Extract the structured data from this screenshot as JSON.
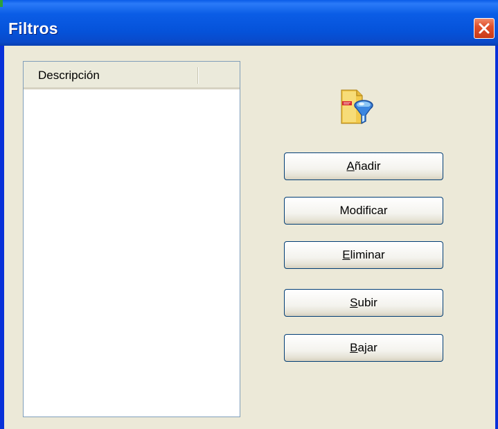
{
  "window": {
    "title": "Filtros",
    "close_icon": "close-icon"
  },
  "list": {
    "columns": [
      "Descripción"
    ],
    "rows": []
  },
  "icon": "filter-funnel-icon",
  "buttons": [
    {
      "key": "add",
      "mnemonic": "A",
      "rest": "ñadir"
    },
    {
      "key": "modify",
      "mnemonic": "",
      "rest": "Modificar"
    },
    {
      "key": "delete",
      "mnemonic": "E",
      "rest": "liminar"
    },
    {
      "key": "up",
      "mnemonic": "S",
      "rest": "ubir"
    },
    {
      "key": "down",
      "mnemonic": "B",
      "rest": "ajar"
    }
  ],
  "colors": {
    "titlebar": "#0552d9",
    "close": "#e0502c",
    "dialog_bg": "#ece9d8"
  }
}
